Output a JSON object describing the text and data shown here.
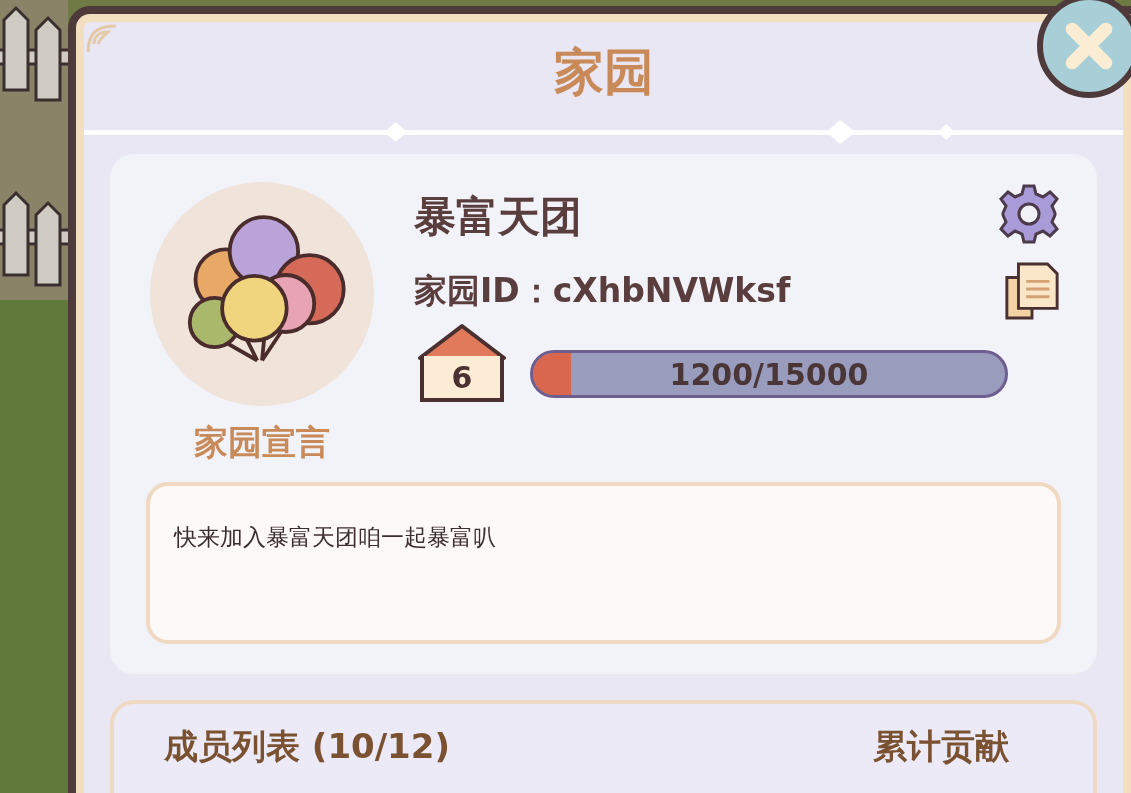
{
  "panel": {
    "title": "家园"
  },
  "home": {
    "name": "暴富天团",
    "id_text": "家园ID：cXhbNVWksf",
    "rank": "6",
    "progress": {
      "level": 0.08,
      "reading": "1200/15000"
    },
    "declaration_label": "家园宣言",
    "declaration": "快来加入暴富天团咱一起暴富叭"
  },
  "members": {
    "title": "成员列表 (10/12)",
    "column_label": "累计贡献"
  }
}
